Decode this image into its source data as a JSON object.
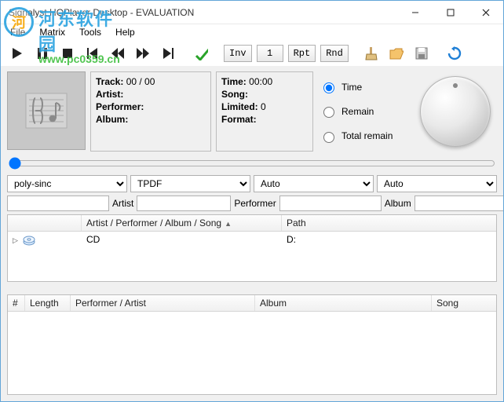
{
  "title": "Signalyst HQPlayer Desktop - EVALUATION",
  "watermark": {
    "name": "河东软件园",
    "url": "www.pc0359.cn"
  },
  "menu": {
    "file": "File",
    "matrix": "Matrix",
    "tools": "Tools",
    "help": "Help"
  },
  "toolbar": {
    "inv": "Inv",
    "phase": "1",
    "rpt": "Rpt",
    "rnd": "Rnd"
  },
  "track_panel": {
    "track_label": "Track:",
    "track_value": "00 / 00",
    "artist_label": "Artist:",
    "artist_value": "",
    "performer_label": "Performer:",
    "performer_value": "",
    "album_label": "Album:",
    "album_value": ""
  },
  "time_panel": {
    "time_label": "Time:",
    "time_value": "00:00",
    "song_label": "Song:",
    "song_value": "",
    "limited_label": "Limited:",
    "limited_value": "0",
    "format_label": "Format:",
    "format_value": ""
  },
  "time_radios": {
    "time": "Time",
    "remain": "Remain",
    "total_remain": "Total remain",
    "selected": "time"
  },
  "drops": {
    "filter": "poly-sinc",
    "dither": "TPDF",
    "rate": "Auto",
    "fmt": "Auto"
  },
  "filter_labels": {
    "artist": "Artist",
    "performer": "Performer",
    "album": "Album"
  },
  "filter_values": {
    "search": "",
    "artist": "",
    "performer": "",
    "album": "",
    "extra": ""
  },
  "library": {
    "headers": {
      "blank": "",
      "main": "Artist / Performer / Album / Song",
      "path": "Path"
    },
    "rows": [
      {
        "label": "CD",
        "path": "D:"
      }
    ]
  },
  "playlist": {
    "headers": {
      "num": "#",
      "length": "Length",
      "perf": "Performer / Artist",
      "album": "Album",
      "song": "Song"
    }
  }
}
